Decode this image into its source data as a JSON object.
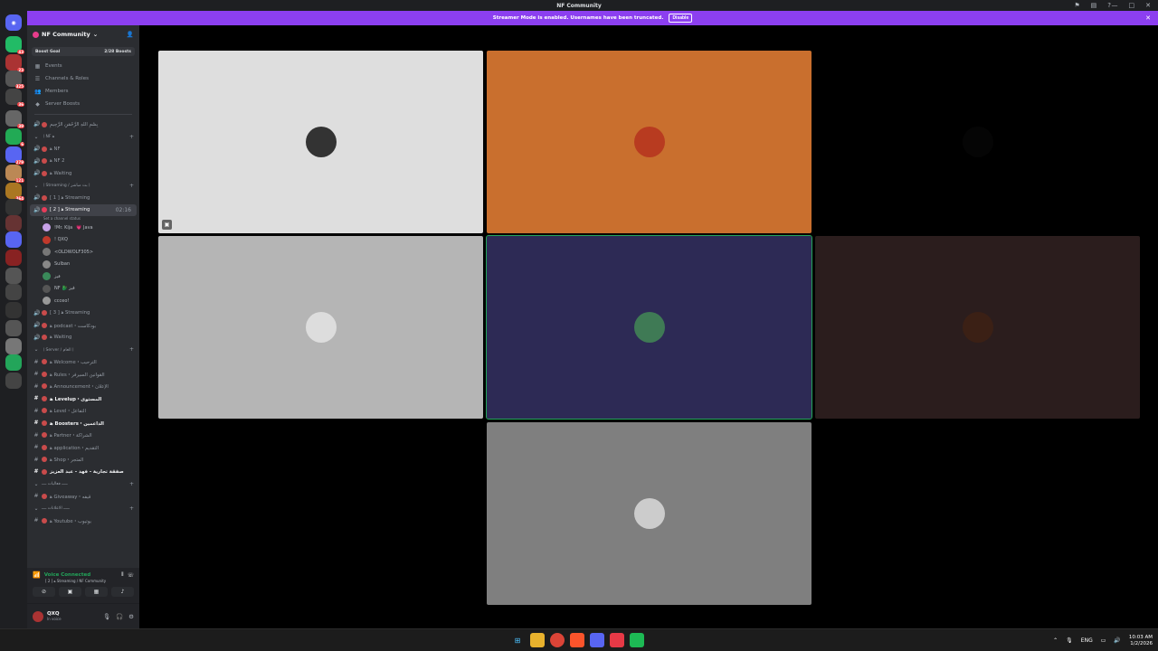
{
  "window": {
    "title": "NF Community"
  },
  "banner": {
    "text": "Streamer Mode is enabled. Usernames have been truncated.",
    "button": "Disable"
  },
  "guild_rail": {
    "badges": [
      "43",
      "23",
      "325",
      "36",
      "39",
      "6",
      "279",
      "121",
      "364"
    ]
  },
  "server": {
    "name": "NF Community",
    "boost": {
      "label": "Boost Goal",
      "progress": "2/28 Boosts"
    },
    "nav": [
      "Events",
      "Channels & Roles",
      "Members",
      "Server Boosts"
    ]
  },
  "channels": [
    {
      "type": "voice",
      "name": "بِسْمِ اللهِ الرَّحْمَنِ الرَّحِيمِ",
      "color": "#949ba4"
    },
    {
      "type": "category",
      "name": "〡NF ﻫ"
    },
    {
      "type": "voice",
      "name": "ﻫ NF",
      "color": "#949ba4"
    },
    {
      "type": "voice",
      "name": "ﻫ NF 2",
      "color": "#949ba4"
    },
    {
      "type": "voice",
      "name": "ﻫ Waiting",
      "color": "#949ba4"
    },
    {
      "type": "category",
      "name": "〡Streaming / بث مباشر〡"
    },
    {
      "type": "voice",
      "name": "[ 1 ] ﻫ Streaming",
      "color": "#949ba4"
    },
    {
      "type": "voice-active",
      "name": "[ 2 ] ﻫ Streaming",
      "status": "Set a channel status",
      "timer": "02:16"
    }
  ],
  "voice_users": [
    {
      "name": "!Mr. Kija",
      "tag": "💗 Java",
      "color": "#c7a2e8"
    },
    {
      "name": "! QXQ",
      "color": "#c0392b"
    },
    {
      "name": "<OLDWOLF305>",
      "color": "#777"
    },
    {
      "name": "Sulban",
      "color": "#888"
    },
    {
      "name": "فيز",
      "color": "#3a8a5a"
    },
    {
      "name": "NF 🐉 ڤيز",
      "color": "#555"
    },
    {
      "name": "ccceo!",
      "color": "#999"
    }
  ],
  "channels_after": [
    {
      "type": "voice",
      "name": "[ 3 ] ﻫ Streaming",
      "kind": "voice"
    },
    {
      "type": "voice",
      "name": "ﻫ podcast・بودكاست",
      "kind": "voice"
    },
    {
      "type": "voice",
      "name": "ﻫ Waiting",
      "kind": "voice"
    },
    {
      "type": "category",
      "name": "〡Server / العام〡"
    },
    {
      "type": "text",
      "name": "ﻫ Welcome・الترحيب",
      "kind": "text"
    },
    {
      "type": "text",
      "name": "ﻫ Rules・القوانين السيرفر",
      "kind": "text"
    },
    {
      "type": "text",
      "name": "ﻫ Announcement・الإعلان",
      "kind": "text"
    },
    {
      "type": "text",
      "name": "ﻫ Levelup・المستوى",
      "kind": "text",
      "bold": true
    },
    {
      "type": "text",
      "name": "ﻫ Level・التفاعل",
      "kind": "text"
    },
    {
      "type": "text",
      "name": "ﻫ Boosters・الداعمين",
      "kind": "text",
      "bold": true
    },
    {
      "type": "text",
      "name": "ﻫ Partner・الشراكة",
      "kind": "text"
    },
    {
      "type": "text",
      "name": "ﻫ application・التقديم",
      "kind": "text"
    },
    {
      "type": "text",
      "name": "ﻫ Shop・المتجر",
      "kind": "text"
    },
    {
      "type": "text",
      "name": "صفقة تجارية - فهد - عبد العزيز",
      "kind": "text",
      "bold": true
    },
    {
      "type": "category",
      "name": "ـــــ فعاليات ــــ"
    },
    {
      "type": "text",
      "name": "ﻫ Giveaway・قيفه",
      "kind": "text"
    },
    {
      "type": "category",
      "name": "ـــــ الاعلانات ــــ"
    },
    {
      "type": "text",
      "name": "ﻫ Youtube・يوتيوب",
      "kind": "text"
    }
  ],
  "voice_panel": {
    "status": "Voice Connected",
    "location": "[ 2 ] ﻫ Streaming / NF Community"
  },
  "user": {
    "name": "QXQ",
    "status": "In voice"
  },
  "tiles": [
    {
      "bg": "#dedede",
      "avatar": "#333"
    },
    {
      "bg": "#c96f2e",
      "avatar": "#b83b20"
    },
    {
      "bg": "#000000",
      "avatar": "#050505"
    },
    {
      "bg": "#b5b5b5",
      "avatar": "#ddd"
    },
    {
      "bg": "#2d2a55",
      "avatar": "#3f7a55"
    },
    {
      "bg": "#2b1d1d",
      "avatar": "#3b2015"
    },
    {
      "bg": "#7f7f7f",
      "avatar": "#ccc"
    }
  ],
  "taskbar": {
    "lang": "ENG",
    "time": "10:03 AM",
    "date": "1/2/2026"
  }
}
